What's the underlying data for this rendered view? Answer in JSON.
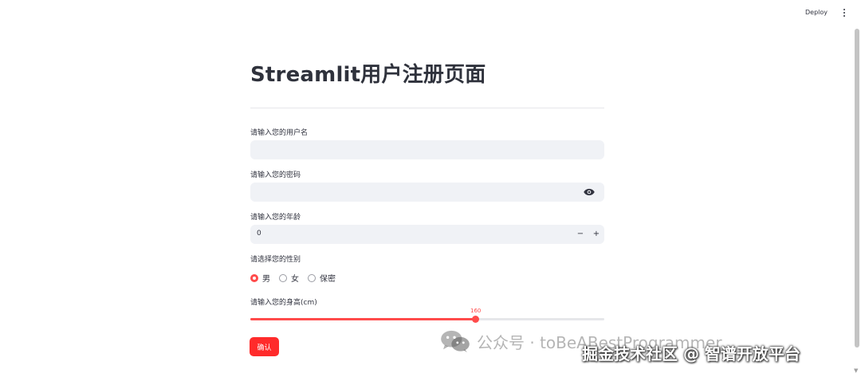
{
  "header": {
    "deploy_label": "Deploy"
  },
  "form": {
    "title": "Streamlit用户注册页面",
    "username": {
      "label": "请输入您的用户名",
      "value": ""
    },
    "password": {
      "label": "请输入您的密码",
      "value": ""
    },
    "age": {
      "label": "请输入您的年龄",
      "value": "0",
      "minus": "−",
      "plus": "+"
    },
    "gender": {
      "label": "请选择您的性别",
      "options": [
        "男",
        "女",
        "保密"
      ],
      "selected": "男"
    },
    "height": {
      "label": "请输入您的身高(cm)",
      "value": "160",
      "fill_fraction": 0.636
    },
    "submit_label": "确认"
  },
  "watermark": {
    "line1": "公众号 · toBeABestProgrammer",
    "line2": "掘金技术社区 @ 智谱开放平台"
  },
  "colors": {
    "accent": "#ff4b4b",
    "button": "#ff2b2b",
    "field_bg": "#f0f2f6"
  },
  "icons": {
    "password_toggle": "eye-icon",
    "menu": "kebab-menu-icon",
    "watermark": "wechat-icon"
  }
}
